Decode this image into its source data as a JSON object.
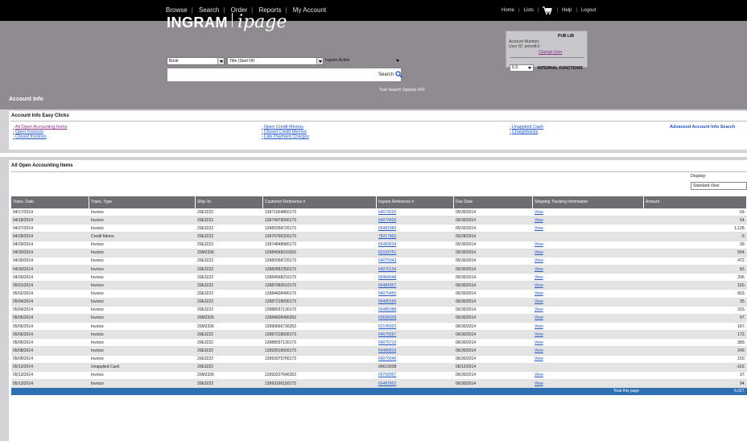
{
  "topbar": {
    "nav": [
      "Browse",
      "Search",
      "Order",
      "Reports",
      "My Account"
    ],
    "right": [
      "Home",
      "Lists",
      "Help",
      "Logout"
    ]
  },
  "logo": {
    "brand": "INGRAM",
    "product": "ipage"
  },
  "search": {
    "format": "Book",
    "field": "Title (Start Of)",
    "filter": "Ingram Active",
    "value": "",
    "button": "Search",
    "options": "Turn Search Options OFF"
  },
  "account": {
    "library": "PUB LIB",
    "number_label": "Account Number:",
    "user_label": "User ID: pmcelh1",
    "change_user": "Change User",
    "internal_select": "ILS",
    "internal_functions": "INTERNAL FUNCTIONS"
  },
  "page_title": "Account Info",
  "easy_clicks": {
    "title": "Account Info Easy Clicks",
    "col1": [
      "All Open Accounting Items",
      "Open Invoices",
      "Closed Invoices"
    ],
    "col2": [
      "Open Credit Memos",
      "Closed Credit Memos",
      "Late Payment Charges"
    ],
    "col3": [
      "Unapplied Cash",
      "Chargebacks"
    ],
    "advanced": "Advanced Account Info Search"
  },
  "open_items": {
    "title": "All Open Accounting Items",
    "display_label": "Display:",
    "view": "Standard View",
    "columns": [
      "Trans. Date",
      "Trans. Type",
      "Ship-To",
      "Customer Reference #",
      "Ingram Reference #",
      "Due Date",
      "Shipping Tracking Information",
      "Amount"
    ],
    "rows": [
      [
        "04/17/2014",
        "Invoice",
        "20E3222",
        "13971604860173",
        "64074220",
        "05/30/2014",
        "View",
        "69."
      ],
      [
        "04/18/2014",
        "Invoice",
        "20E3222",
        "13974979590173",
        "64074425",
        "05/30/2014",
        "View",
        "54."
      ],
      [
        "04/27/2014",
        "Invoice",
        "20E3222",
        "13982058720173",
        "66482980",
        "05/30/2014",
        "View",
        "1,128."
      ],
      [
        "04/28/2014",
        "Credit Memo",
        "20E3222",
        "13970790320173",
        "78317862",
        "05/28/2014",
        "",
        "-3."
      ],
      [
        "04/29/2014",
        "Invoice",
        "20E3222",
        "13974848980173",
        "66483634",
        "05/30/2014",
        "View",
        "39."
      ],
      [
        "04/30/2014",
        "Invoice",
        "20M2336",
        "13984568210263",
        "62193751",
        "05/30/2014",
        "View",
        "554."
      ],
      [
        "04/30/2014",
        "Invoice",
        "20E3222",
        "13982058720173",
        "64075043",
        "05/30/2014",
        "View",
        "472."
      ],
      [
        "04/30/2014",
        "Invoice",
        "20E3222",
        "13982892350173",
        "64075194",
        "05/30/2014",
        "View",
        "83."
      ],
      [
        "04/30/2014",
        "Invoice",
        "20E3222",
        "13984568210173",
        "66484048",
        "05/30/2014",
        "View",
        "296."
      ],
      [
        "05/01/2014",
        "Invoice",
        "20E3222",
        "13987060510173",
        "66484307",
        "06/30/2014",
        "View",
        "160."
      ],
      [
        "05/02/2014",
        "Invoice",
        "20E3222",
        "13984608490173",
        "64075455",
        "06/30/2014",
        "View",
        "603."
      ],
      [
        "05/04/2014",
        "Invoice",
        "20E3222",
        "13987218930173",
        "66485195",
        "06/30/2014",
        "View",
        "35."
      ],
      [
        "05/04/2014",
        "Invoice",
        "20E3222",
        "13988037130173",
        "66485388",
        "06/30/2014",
        "View",
        "315."
      ],
      [
        "05/05/2014",
        "Invoice",
        "20M2336",
        "13984608490263",
        "60696028",
        "06/30/2014",
        "View",
        "97."
      ],
      [
        "05/06/2014",
        "Invoice",
        "20M2336",
        "13990666730263",
        "62195023",
        "06/30/2014",
        "View",
        "187."
      ],
      [
        "05/06/2014",
        "Invoice",
        "20E3222",
        "13987218930173",
        "64075567",
        "06/30/2014",
        "View",
        "172."
      ],
      [
        "05/06/2014",
        "Invoice",
        "20E3222",
        "13988037130173",
        "64075710",
        "06/30/2014",
        "View",
        "389."
      ],
      [
        "05/08/2014",
        "Invoice",
        "20E3222",
        "13993016500173",
        "66486829",
        "06/30/2014",
        "View",
        "249."
      ],
      [
        "05/09/2014",
        "Invoice",
        "20E3222",
        "13993075700173",
        "64076046",
        "06/30/2014",
        "View",
        "150."
      ],
      [
        "05/12/2014",
        "Unapplied Cash",
        "20E3222",
        "",
        "00619208",
        "05/12/2014",
        "",
        "-162."
      ],
      [
        "05/13/2014",
        "Invoice",
        "20M2336",
        "13993227640263",
        "60700007",
        "06/30/2014",
        "View",
        "37."
      ],
      [
        "05/13/2014",
        "Invoice",
        "20E3222",
        "13993196150173",
        "66487602",
        "06/30/2014",
        "View",
        "94."
      ]
    ],
    "total_label": "Total this page",
    "total_value": "5,027."
  },
  "colors": {
    "topbar": "#000000",
    "header": "#8f8b91",
    "table_header": "#6f6d73",
    "link": "#1f56c7",
    "total_bar": "#2e6fb1"
  }
}
